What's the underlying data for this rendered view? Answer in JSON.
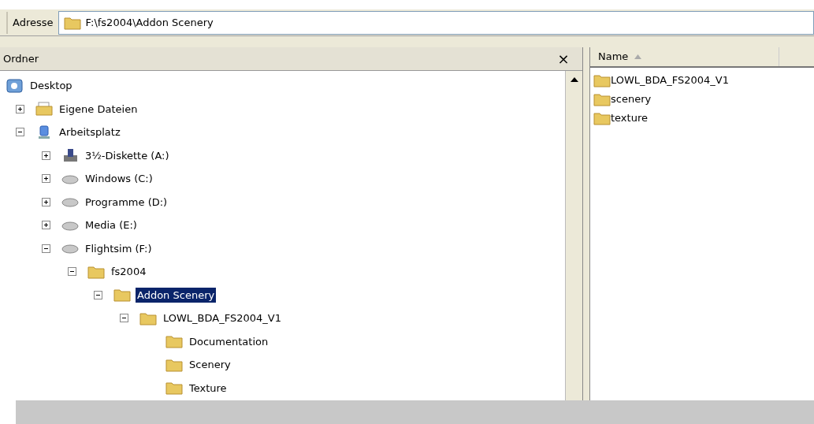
{
  "address_bar": {
    "label": "Adresse",
    "value": "F:\\fs2004\\Addon Scenery"
  },
  "folders_pane": {
    "title": "Ordner",
    "close": "×",
    "tree": [
      {
        "label": "Desktop",
        "kind": "desktop",
        "selected": false,
        "children": [
          {
            "label": "Eigene Dateien",
            "kind": "documents",
            "expanded": false,
            "selected": false
          },
          {
            "label": "Arbeitsplatz",
            "kind": "computer",
            "expanded": true,
            "selected": false,
            "children": [
              {
                "label": "3½-Diskette (A:)",
                "kind": "floppy",
                "expanded": false,
                "selected": false
              },
              {
                "label": "Windows (C:)",
                "kind": "drive",
                "expanded": false,
                "selected": false
              },
              {
                "label": "Programme (D:)",
                "kind": "drive",
                "expanded": false,
                "selected": false
              },
              {
                "label": "Media (E:)",
                "kind": "drive",
                "expanded": false,
                "selected": false
              },
              {
                "label": "Flightsim (F:)",
                "kind": "drive",
                "expanded": true,
                "selected": false,
                "children": [
                  {
                    "label": "fs2004",
                    "kind": "folder",
                    "expanded": true,
                    "selected": false,
                    "children": [
                      {
                        "label": "Addon Scenery",
                        "kind": "folder",
                        "expanded": true,
                        "selected": true,
                        "children": [
                          {
                            "label": "LOWL_BDA_FS2004_V1",
                            "kind": "folder",
                            "expanded": true,
                            "selected": false,
                            "children": [
                              {
                                "label": "Documentation",
                                "kind": "folder",
                                "selected": false
                              },
                              {
                                "label": "Scenery",
                                "kind": "folder",
                                "selected": false
                              },
                              {
                                "label": "Texture",
                                "kind": "folder",
                                "selected": false
                              }
                            ]
                          }
                        ]
                      }
                    ]
                  }
                ]
              }
            ]
          }
        ]
      }
    ]
  },
  "file_list": {
    "columns": [
      "Name"
    ],
    "items": [
      {
        "name": "LOWL_BDA_FS2004_V1"
      },
      {
        "name": "scenery"
      },
      {
        "name": "texture"
      }
    ]
  }
}
